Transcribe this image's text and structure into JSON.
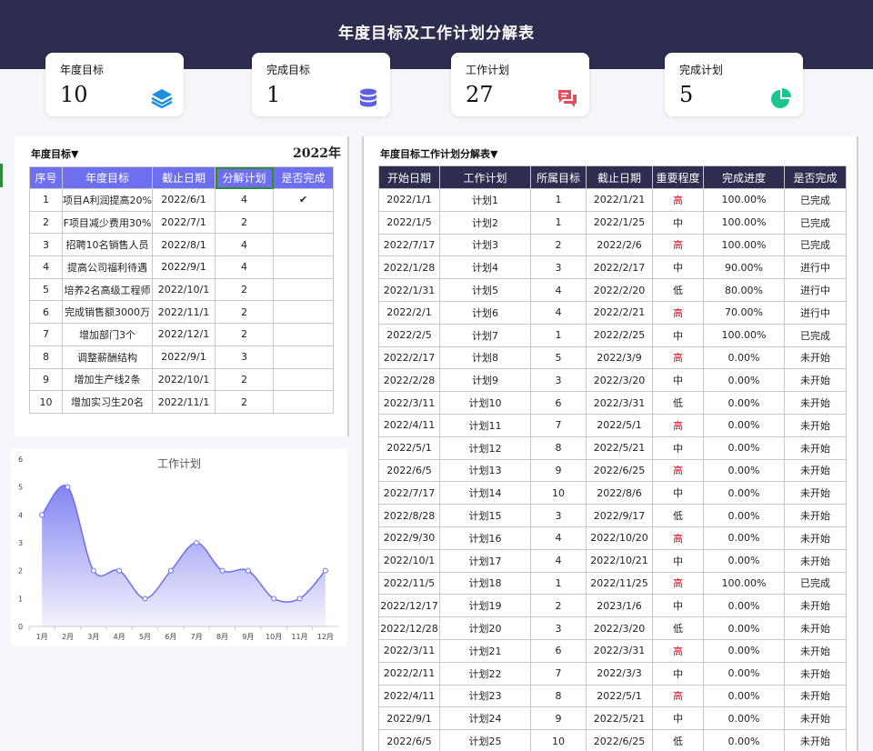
{
  "title": "年度目标及工作计划分解表",
  "kpis": [
    {
      "label": "年度目标",
      "value": "10",
      "icon": "layers-icon",
      "color": "#1e8fe0"
    },
    {
      "label": "完成目标",
      "value": "1",
      "icon": "database-icon",
      "color": "#5b5fe0"
    },
    {
      "label": "工作计划",
      "value": "27",
      "icon": "chat-icon",
      "color": "#e84c5a"
    },
    {
      "label": "完成计划",
      "value": "5",
      "icon": "pie-chart-icon",
      "color": "#1cc58f"
    }
  ],
  "goals": {
    "title": "年度目标▼",
    "year": "2022年",
    "columns": [
      "序号",
      "年度目标",
      "截止日期",
      "分解计划",
      "是否完成"
    ],
    "rows": [
      [
        "1",
        "项目A利润提高20%",
        "2022/6/1",
        "4",
        "✔"
      ],
      [
        "2",
        "F项目减少费用30%",
        "2022/7/1",
        "2",
        ""
      ],
      [
        "3",
        "招聘10名销售人员",
        "2022/8/1",
        "4",
        ""
      ],
      [
        "4",
        "提高公司福利待遇",
        "2022/9/1",
        "4",
        ""
      ],
      [
        "5",
        "培养2名高级工程师",
        "2022/10/1",
        "2",
        ""
      ],
      [
        "6",
        "完成销售额3000万",
        "2022/11/1",
        "2",
        ""
      ],
      [
        "7",
        "增加部门3个",
        "2022/12/1",
        "2",
        ""
      ],
      [
        "8",
        "调整薪酬结构",
        "2022/9/1",
        "3",
        ""
      ],
      [
        "9",
        "增加生产线2条",
        "2022/10/1",
        "2",
        ""
      ],
      [
        "10",
        "增加实习生20名",
        "2022/11/1",
        "2",
        ""
      ]
    ]
  },
  "plans": {
    "title": "年度目标工作计划分解表▼",
    "columns": [
      "开始日期",
      "工作计划",
      "所属目标",
      "截止日期",
      "重要程度",
      "完成进度",
      "是否完成"
    ],
    "rows": [
      [
        "2022/1/1",
        "计划1",
        "1",
        "2022/1/21",
        "高",
        "100.00%",
        "已完成"
      ],
      [
        "2022/1/5",
        "计划2",
        "1",
        "2022/1/25",
        "中",
        "100.00%",
        "已完成"
      ],
      [
        "2022/7/17",
        "计划3",
        "2",
        "2022/2/6",
        "高",
        "100.00%",
        "已完成"
      ],
      [
        "2022/1/28",
        "计划4",
        "3",
        "2022/2/17",
        "中",
        "90.00%",
        "进行中"
      ],
      [
        "2022/1/31",
        "计划5",
        "4",
        "2022/2/20",
        "低",
        "80.00%",
        "进行中"
      ],
      [
        "2022/2/1",
        "计划6",
        "4",
        "2022/2/21",
        "高",
        "70.00%",
        "进行中"
      ],
      [
        "2022/2/5",
        "计划7",
        "1",
        "2022/2/25",
        "中",
        "100.00%",
        "已完成"
      ],
      [
        "2022/2/17",
        "计划8",
        "5",
        "2022/3/9",
        "高",
        "0.00%",
        "未开始"
      ],
      [
        "2022/2/28",
        "计划9",
        "3",
        "2022/3/20",
        "中",
        "0.00%",
        "未开始"
      ],
      [
        "2022/3/11",
        "计划10",
        "6",
        "2022/3/31",
        "低",
        "0.00%",
        "未开始"
      ],
      [
        "2022/4/11",
        "计划11",
        "7",
        "2022/5/1",
        "高",
        "0.00%",
        "未开始"
      ],
      [
        "2022/5/1",
        "计划12",
        "8",
        "2022/5/21",
        "中",
        "0.00%",
        "未开始"
      ],
      [
        "2022/6/5",
        "计划13",
        "9",
        "2022/6/25",
        "高",
        "0.00%",
        "未开始"
      ],
      [
        "2022/7/17",
        "计划14",
        "10",
        "2022/8/6",
        "中",
        "0.00%",
        "未开始"
      ],
      [
        "2022/8/28",
        "计划15",
        "3",
        "2022/9/17",
        "低",
        "0.00%",
        "未开始"
      ],
      [
        "2022/9/30",
        "计划16",
        "4",
        "2022/10/20",
        "高",
        "0.00%",
        "未开始"
      ],
      [
        "2022/10/1",
        "计划17",
        "4",
        "2022/10/21",
        "中",
        "0.00%",
        "未开始"
      ],
      [
        "2022/11/5",
        "计划18",
        "1",
        "2022/11/25",
        "高",
        "100.00%",
        "已完成"
      ],
      [
        "2022/12/17",
        "计划19",
        "2",
        "2023/1/6",
        "中",
        "0.00%",
        "未开始"
      ],
      [
        "2022/12/28",
        "计划20",
        "3",
        "2022/3/20",
        "低",
        "0.00%",
        "未开始"
      ],
      [
        "2022/3/11",
        "计划21",
        "6",
        "2022/3/31",
        "高",
        "0.00%",
        "未开始"
      ],
      [
        "2022/2/11",
        "计划22",
        "7",
        "2022/3/3",
        "中",
        "0.00%",
        "未开始"
      ],
      [
        "2022/4/11",
        "计划23",
        "8",
        "2022/5/1",
        "高",
        "0.00%",
        "未开始"
      ],
      [
        "2022/9/1",
        "计划24",
        "9",
        "2022/5/21",
        "中",
        "0.00%",
        "未开始"
      ],
      [
        "2022/6/5",
        "计划25",
        "10",
        "2022/6/25",
        "低",
        "0.00%",
        "未开始"
      ]
    ]
  },
  "chart_data": {
    "type": "area",
    "title": "工作计划",
    "categories": [
      "1月",
      "2月",
      "3月",
      "4月",
      "5月",
      "6月",
      "7月",
      "8月",
      "9月",
      "10月",
      "11月",
      "12月"
    ],
    "values": [
      4,
      5,
      2,
      2,
      1,
      2,
      3,
      2,
      2,
      1,
      1,
      2
    ],
    "ylim": [
      0,
      6
    ],
    "yticks": [
      "0",
      "1",
      "2",
      "3",
      "4",
      "5",
      "6"
    ],
    "color": "#6e6fee",
    "grid": false
  }
}
